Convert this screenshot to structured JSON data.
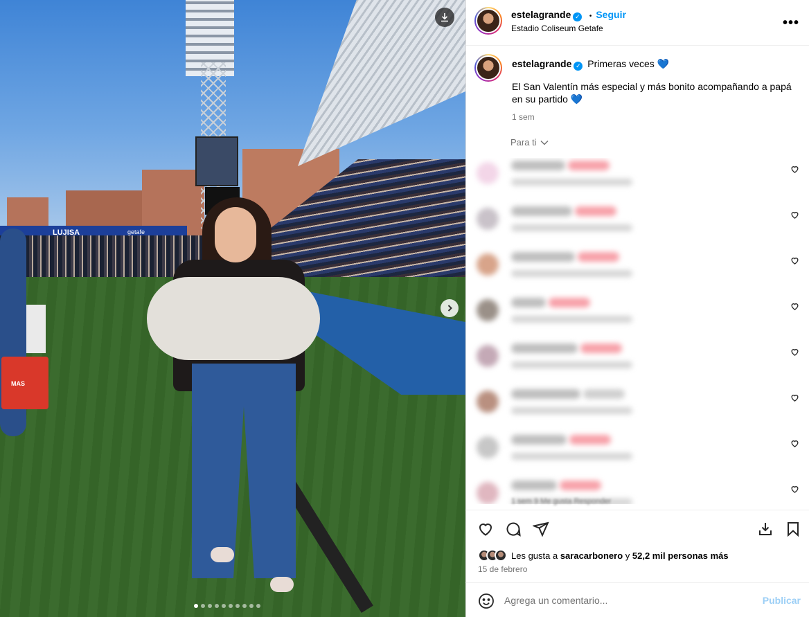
{
  "post": {
    "username": "estelagrande",
    "follow_label": "Seguir",
    "location": "Estadio Coliseum Getafe",
    "more_label": "•••"
  },
  "photo": {
    "signage": {
      "board1": "LUJISA",
      "board2": "getafe",
      "case_label": "MAS"
    },
    "slide_count": 10,
    "active_slide": 1
  },
  "caption": {
    "username": "estelagrande",
    "title": "Primeras veces 💙",
    "body": "El San Valentín más especial y más bonito acompañando a papá en su partido 💙",
    "time": "1 sem"
  },
  "comments_header": {
    "label": "Para ti"
  },
  "comments": [
    {
      "avatar_color": "#f3d6e8",
      "name_width": 78,
      "tag_color": "#f7a0a8"
    },
    {
      "avatar_color": "#c9c2c9",
      "name_width": 88,
      "tag_color": "#f7a0a8"
    },
    {
      "avatar_color": "#d8a48a",
      "name_width": 92,
      "tag_color": "#f7a0a8"
    },
    {
      "avatar_color": "#9a9088",
      "name_width": 50,
      "tag_color": "#f7a0a8"
    },
    {
      "avatar_color": "#c4a9b6",
      "name_width": 96,
      "tag_color": "#f7a0a8"
    },
    {
      "avatar_color": "#b99080",
      "name_width": 100,
      "tag_color": "#cfcfcf"
    },
    {
      "avatar_color": "#c7c7c7",
      "name_width": 80,
      "tag_color": "#f7a0a8"
    },
    {
      "avatar_color": "#e0b7c0",
      "name_width": 66,
      "tag_color": "#f7a0a8"
    }
  ],
  "last_comment_meta": "1 sem   9 Me gusta   Responder",
  "actions": {
    "likes_prefix": "Les gusta a ",
    "likes_user": "saracarbonero",
    "likes_middle": " y ",
    "likes_count": "52,2 mil personas más",
    "date": "15 de febrero"
  },
  "comment_box": {
    "placeholder": "Agrega un comentario...",
    "publish_label": "Publicar"
  },
  "colors": {
    "accent": "#0095f6",
    "muted": "#737373",
    "border": "#dbdbdb"
  }
}
